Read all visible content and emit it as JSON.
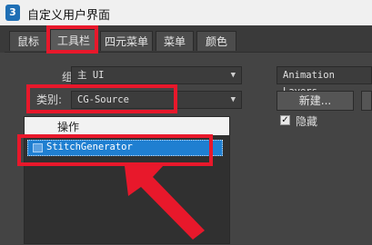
{
  "window": {
    "title": "自定义用户界面",
    "app_icon_text": "3"
  },
  "tabs": [
    {
      "label": "鼠标"
    },
    {
      "label": "工具栏"
    },
    {
      "label": "四元菜单"
    },
    {
      "label": "菜单"
    },
    {
      "label": "颜色"
    }
  ],
  "panel": {
    "group_label": "组:",
    "group_value": "主 UI",
    "category_label": "类别:",
    "category_value": "CG-Source",
    "list_header": "操作",
    "list_items": [
      {
        "label": "StitchGenerator",
        "selected": true
      }
    ]
  },
  "right": {
    "layers_value": "Animation Layers",
    "new_button": "新建...",
    "hide_label": "隐藏",
    "hide_checked": true
  },
  "colors": {
    "highlight_red": "#e8182b",
    "selection_blue": "#1f7fd1"
  }
}
